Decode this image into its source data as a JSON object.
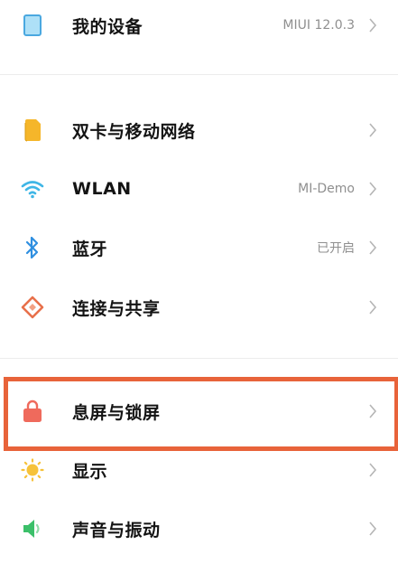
{
  "settings": {
    "device": {
      "label": "我的设备",
      "value": "MIUI 12.0.3",
      "icon": "device-icon"
    },
    "sim": {
      "label": "双卡与移动网络",
      "icon": "sim-card-icon"
    },
    "wlan": {
      "label": "WLAN",
      "value": "MI-Demo",
      "icon": "wifi-icon"
    },
    "bluetooth": {
      "label": "蓝牙",
      "value": "已开启",
      "icon": "bluetooth-icon"
    },
    "connection": {
      "label": "连接与共享",
      "icon": "connection-share-icon"
    },
    "lockscreen": {
      "label": "息屏与锁屏",
      "icon": "lock-icon"
    },
    "display": {
      "label": "显示",
      "icon": "sun-icon"
    },
    "sound": {
      "label": "声音与振动",
      "icon": "speaker-icon"
    }
  },
  "colors": {
    "highlight": "#e8633a",
    "device_icon": "#4aa8e0",
    "sim_icon": "#f5b62a",
    "wifi_icon": "#3fb6e6",
    "bluetooth_icon": "#2f8fe0",
    "connection_icon": "#e8704a",
    "lock_icon": "#ef6a5c",
    "sun_icon": "#f6c23a",
    "speaker_icon": "#3cc06a"
  }
}
